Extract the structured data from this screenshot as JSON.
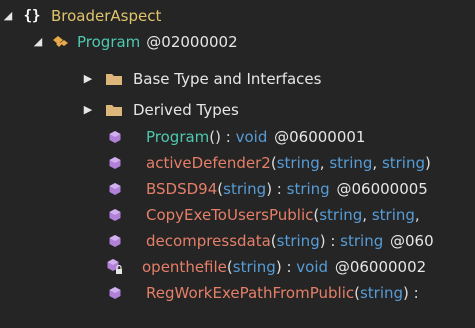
{
  "tree": {
    "namespace": {
      "expander": "◢",
      "icon": "braces-icon",
      "icon_text": "{}",
      "label": "BroaderAspect"
    },
    "class": {
      "expander": "◢",
      "icon": "class-icon",
      "label": "Program",
      "token": "@02000002"
    },
    "folders": [
      {
        "expander": "▶",
        "icon": "folder-icon",
        "label": "Base Type and Interfaces"
      },
      {
        "expander": "▶",
        "icon": "folder-icon",
        "label": "Derived Types"
      }
    ],
    "members": [
      {
        "icon": "method-icon",
        "name": "Program",
        "kind": "ctor",
        "params": [],
        "sig_tail": "() : ",
        "ret": "void",
        "token": "@06000001"
      },
      {
        "icon": "method-icon",
        "name": "activeDefender2",
        "kind": "method",
        "sig_open": "(",
        "p1": "string",
        "c1": ", ",
        "p2": "string",
        "c2": ", ",
        "p3": "string",
        "sig_close": ")"
      },
      {
        "icon": "method-icon",
        "name": "BSDSD94",
        "kind": "method",
        "sig_open": "(",
        "p1": "string",
        "sig_mid": ") : ",
        "ret": "string",
        "token": "@06000005"
      },
      {
        "icon": "method-icon",
        "name": "CopyExeToUsersPublic",
        "kind": "method",
        "sig_open": "(",
        "p1": "string",
        "c1": ", ",
        "p2": "string",
        "c2": ","
      },
      {
        "icon": "method-icon",
        "name": "decompressdata",
        "kind": "method",
        "sig_open": "(",
        "p1": "string",
        "sig_mid": ") : ",
        "ret": "string",
        "token": "@060"
      },
      {
        "icon": "static-method-icon",
        "name": "openthefile",
        "kind": "method",
        "sig_open": "(",
        "p1": "string",
        "sig_mid": ") : ",
        "ret": "void",
        "token": "@06000002"
      },
      {
        "icon": "method-icon",
        "name": "RegWorkExePathFromPublic",
        "kind": "method",
        "sig_open": "(",
        "p1": "string",
        "sig_mid": ") :"
      }
    ]
  },
  "colors": {
    "background": "#252526",
    "namespace": "#e0c46c",
    "class": "#4ec9b0",
    "method": "#e57f68",
    "keyword": "#569cd6",
    "method_icon": "#b180d7",
    "folder": "#dcb67a"
  }
}
